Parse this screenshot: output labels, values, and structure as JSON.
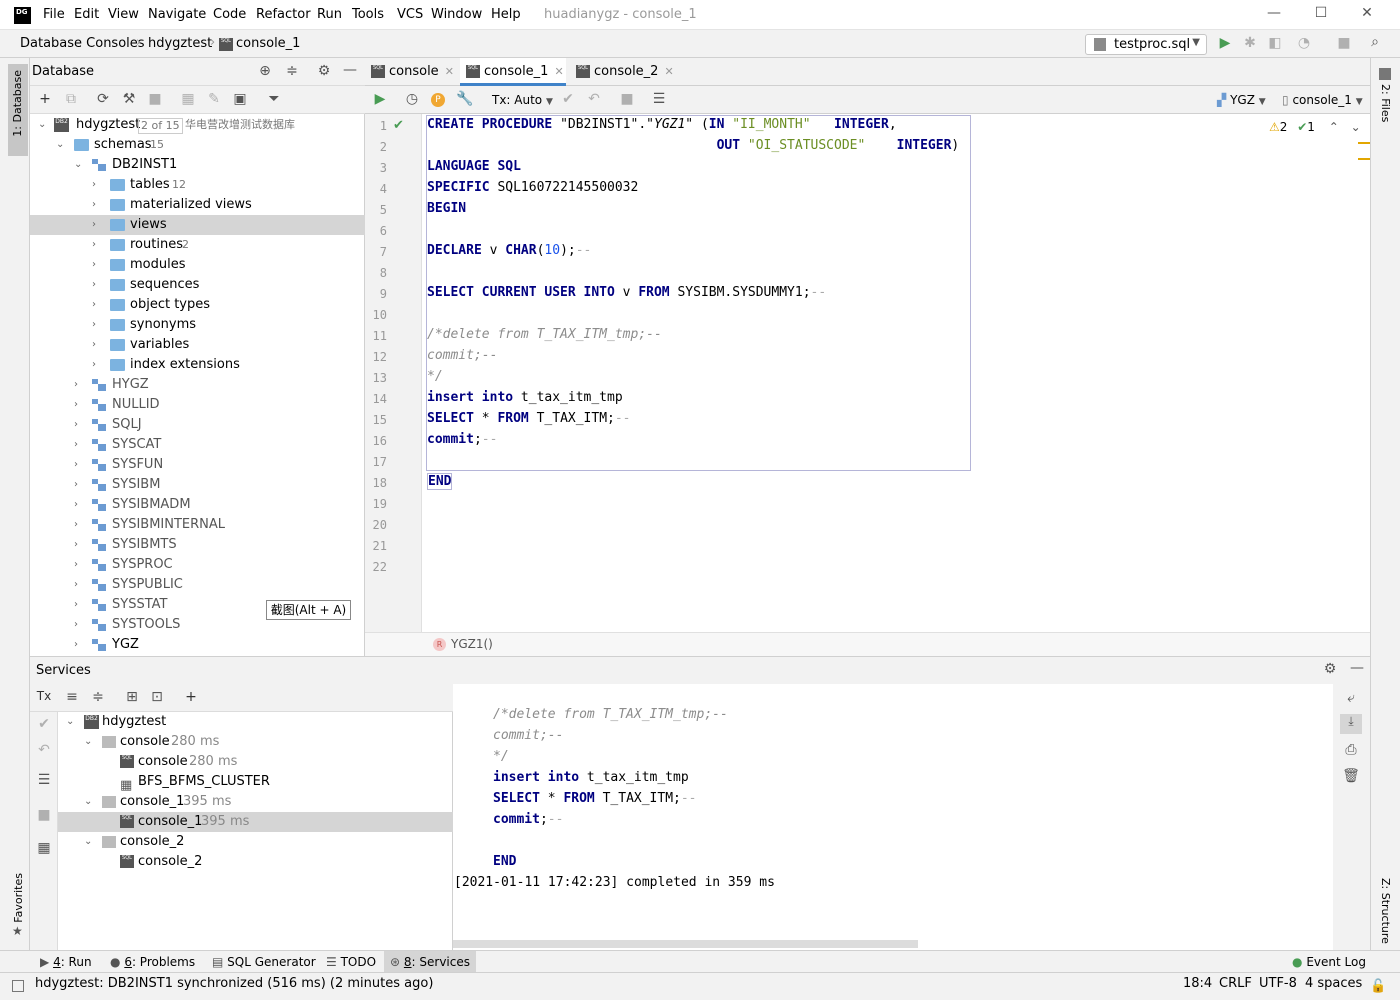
{
  "window": {
    "title": "huadianygz - console_1"
  },
  "menu": [
    "File",
    "Edit",
    "View",
    "Navigate",
    "Code",
    "Refactor",
    "Run",
    "Tools",
    "VCS",
    "Window",
    "Help"
  ],
  "breadcrumb": [
    "Database Consoles",
    "hdygztest",
    "console_1"
  ],
  "run_config": "testproc.sql",
  "left_strip": {
    "database_tab": "1: Database",
    "favorites_tab": "Favorites"
  },
  "right_strip": {
    "files_tab": "2: Files",
    "structure_tab": "Z: Structure"
  },
  "db_panel": {
    "title": "Database",
    "tree": [
      {
        "label": "hdygztest",
        "count": "2 of 15",
        "comment": "华电营改增测试数据库"
      },
      {
        "label": "schemas",
        "count": "15"
      },
      {
        "label": "DB2INST1"
      },
      {
        "label": "tables",
        "count": "12"
      },
      {
        "label": "materialized views"
      },
      {
        "label": "views"
      },
      {
        "label": "routines",
        "count": "2"
      },
      {
        "label": "modules"
      },
      {
        "label": "sequences"
      },
      {
        "label": "object types"
      },
      {
        "label": "synonyms"
      },
      {
        "label": "variables"
      },
      {
        "label": "index extensions"
      },
      {
        "label": "HYGZ"
      },
      {
        "label": "NULLID"
      },
      {
        "label": "SQLJ"
      },
      {
        "label": "SYSCAT"
      },
      {
        "label": "SYSFUN"
      },
      {
        "label": "SYSIBM"
      },
      {
        "label": "SYSIBMADM"
      },
      {
        "label": "SYSIBMINTERNAL"
      },
      {
        "label": "SYSIBMTS"
      },
      {
        "label": "SYSPROC"
      },
      {
        "label": "SYSPUBLIC"
      },
      {
        "label": "SYSSTAT"
      },
      {
        "label": "SYSTOOLS"
      },
      {
        "label": "YGZ"
      }
    ],
    "tooltip": "截图(Alt + A)"
  },
  "editor": {
    "tabs": [
      "console",
      "console_1",
      "console_2"
    ],
    "tx_mode": "Tx: Auto",
    "schema": "YGZ",
    "session": "console_1",
    "warnings": "2",
    "checks": "1",
    "line_numbers": [
      "1",
      "2",
      "3",
      "4",
      "5",
      "6",
      "7",
      "8",
      "9",
      "10",
      "11",
      "12",
      "13",
      "14",
      "15",
      "16",
      "17",
      "18",
      "19",
      "20",
      "21",
      "22"
    ],
    "breadcrumb": "YGZ1()"
  },
  "services": {
    "title": "Services",
    "tree": [
      {
        "label": "hdygztest",
        "time": ""
      },
      {
        "label": "console",
        "time": "280 ms"
      },
      {
        "label": "console",
        "time": "280 ms"
      },
      {
        "label": "BFS_BFMS_CLUSTER",
        "time": ""
      },
      {
        "label": "console_1",
        "time": "395 ms"
      },
      {
        "label": "console_1",
        "time": "395 ms"
      },
      {
        "label": "console_2",
        "time": ""
      },
      {
        "label": "console_2",
        "time": ""
      }
    ],
    "output_time": "[2021-01-11 17:42:23] completed in 359 ms"
  },
  "bottom_tabs": [
    {
      "num": "4",
      "label": ": Run"
    },
    {
      "num": "6",
      "label": ": Problems"
    },
    {
      "num": "",
      "label": "SQL Generator"
    },
    {
      "num": "",
      "label": "TODO"
    },
    {
      "num": "8",
      "label": ": Services"
    }
  ],
  "event_log": "Event Log",
  "status": {
    "message": "hdygztest: DB2INST1 synchronized (516 ms) (2 minutes ago)",
    "position": "18:4",
    "line_sep": "CRLF",
    "encoding": "UTF-8",
    "indent": "4 spaces"
  }
}
